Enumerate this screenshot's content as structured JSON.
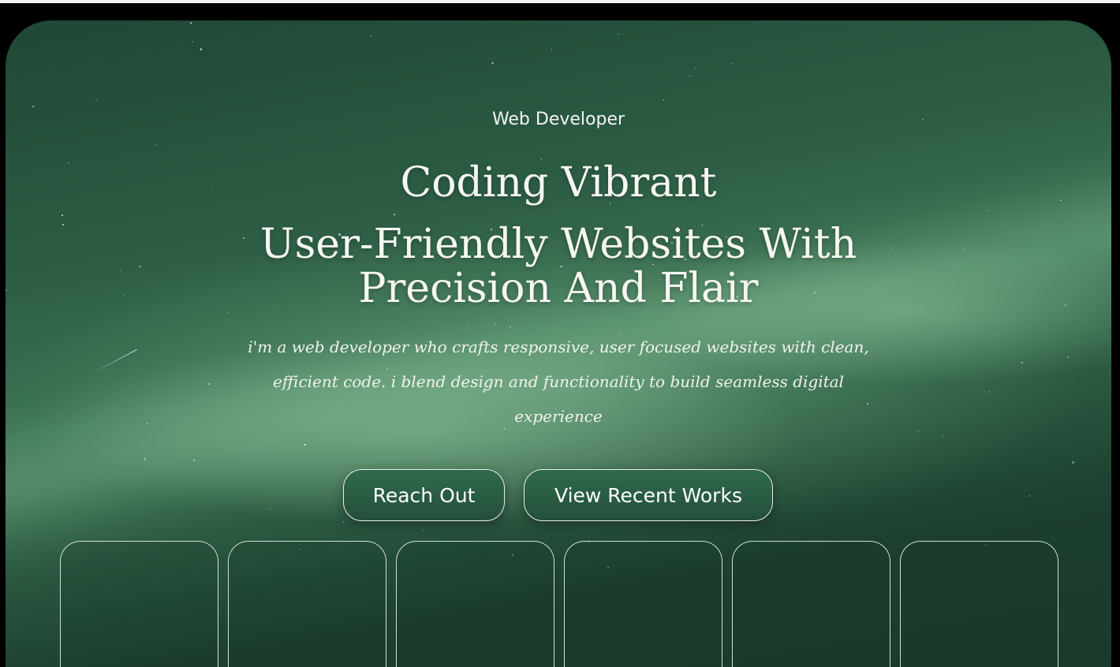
{
  "hero": {
    "role": "Web Developer",
    "headline_line1": "Coding Vibrant",
    "headline_line2": "User-Friendly Websites With",
    "headline_line3": "Precision And Flair",
    "description": "i'm a web developer who crafts responsive, user focused websites with clean, efficient code. i blend design and functionality to build seamless digital experience",
    "buttons": {
      "reach_out": "Reach Out",
      "view_works": "View Recent Works"
    }
  },
  "cards": [
    {
      "label": ""
    },
    {
      "label": ""
    },
    {
      "label": ""
    },
    {
      "label": ""
    },
    {
      "label": ""
    },
    {
      "label": ""
    }
  ],
  "colors": {
    "background_dark": "#1a3a2b",
    "aurora_green": "#3e7556",
    "button_fill": "#2f6a4e",
    "text": "#ffffff"
  }
}
